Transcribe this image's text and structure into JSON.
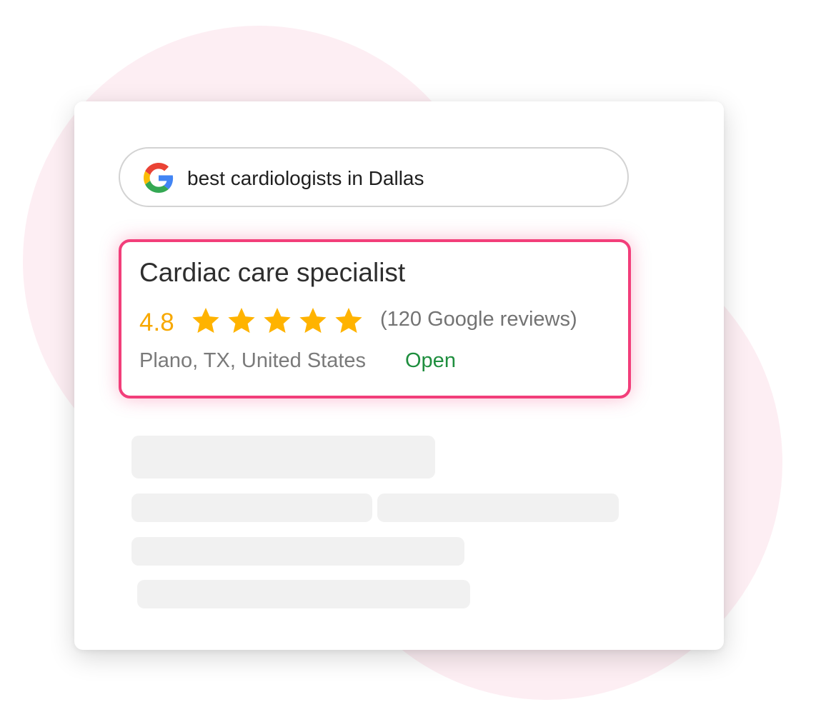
{
  "search": {
    "query": "best cardiologists in Dallas",
    "logo_icon": "google-g-icon"
  },
  "result": {
    "title": "Cardiac care specialist",
    "rating": "4.8",
    "stars_filled": 5,
    "stars_total": 5,
    "reviews": "(120 Google reviews)",
    "location": "Plano, TX, United States",
    "status": "Open"
  },
  "colors": {
    "highlight_border": "#f23e7a",
    "rating": "#f7a800",
    "star": "#ffb300",
    "status_open": "#1e8e3e",
    "background_blob": "#fdeef3",
    "skeleton": "#f1f1f1"
  }
}
